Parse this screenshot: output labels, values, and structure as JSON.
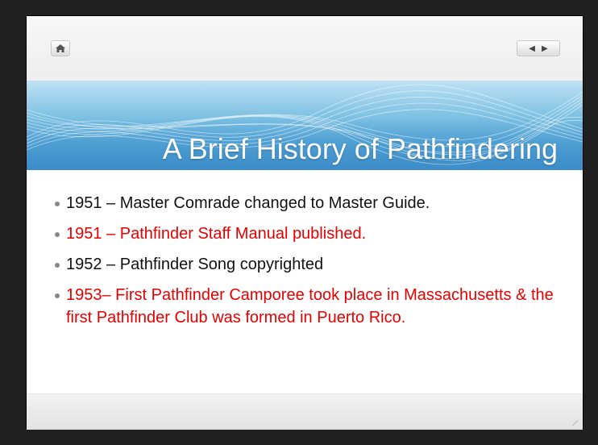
{
  "toolbar": {
    "home_icon": "home-icon",
    "prev_icon": "◀",
    "next_icon": "▶"
  },
  "slide": {
    "title": "A Brief History of Pathfindering",
    "bullets": [
      {
        "text": "1951 – Master Comrade changed to Master Guide.",
        "color": "#111111"
      },
      {
        "text": "1951 – Pathfinder Staff Manual published.",
        "color": "#e60000"
      },
      {
        "text": "1952 – Pathfinder Song copyrighted",
        "color": "#111111"
      },
      {
        "text": "1953– First Pathfinder Camporee took place in Massachusetts & the first Pathfinder Club was formed in Puerto Rico.",
        "color": "#e60000"
      }
    ]
  },
  "colors": {
    "banner_top": "#bfe2f3",
    "banner_bottom": "#3b8bc8",
    "highlight": "#e60000"
  }
}
